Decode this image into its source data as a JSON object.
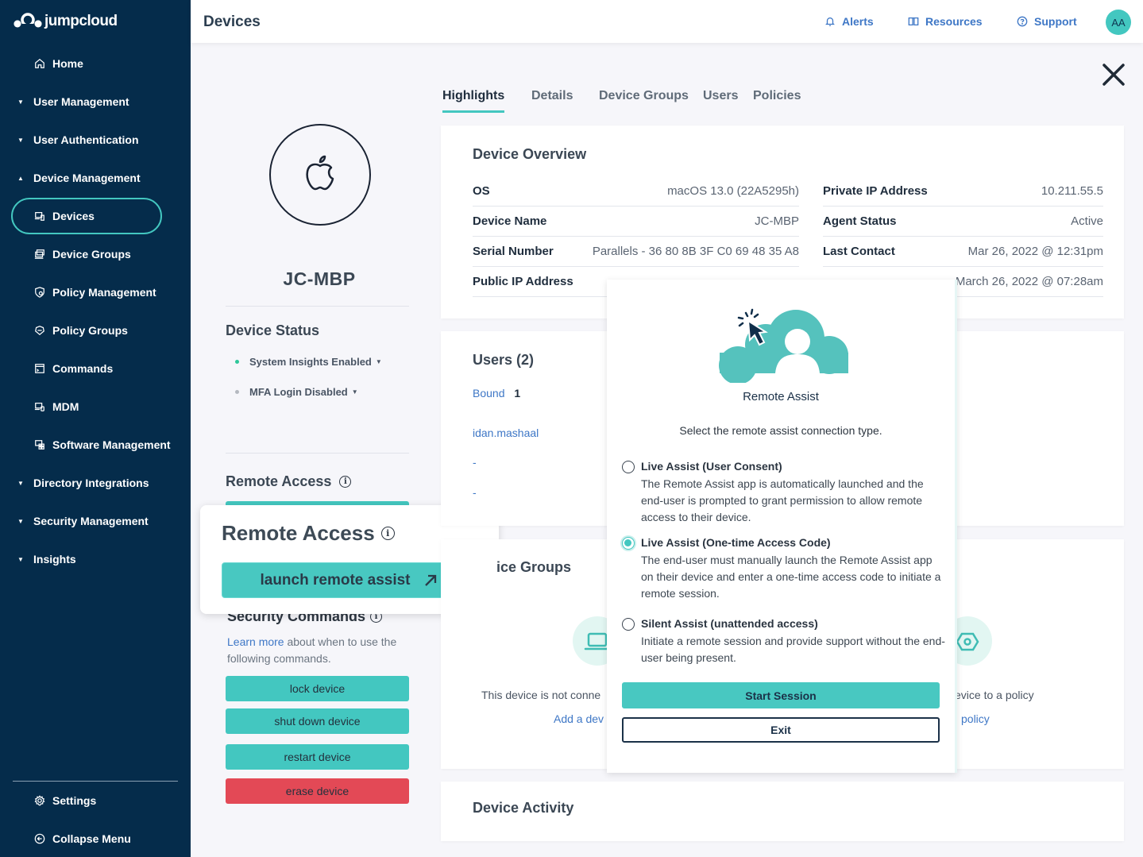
{
  "app": {
    "brand": "jumpcloud"
  },
  "sidebar": {
    "items": [
      {
        "label": "Home",
        "icon": "home-icon",
        "type": "top"
      },
      {
        "label": "User Management",
        "type": "group",
        "expanded": false
      },
      {
        "label": "User Authentication",
        "type": "group",
        "expanded": false
      },
      {
        "label": "Device Management",
        "type": "group",
        "expanded": true
      },
      {
        "label": "Devices",
        "icon": "devices-icon",
        "type": "child",
        "active": true
      },
      {
        "label": "Device Groups",
        "icon": "device-groups-icon",
        "type": "child"
      },
      {
        "label": "Policy Management",
        "icon": "policy-management-icon",
        "type": "child"
      },
      {
        "label": "Policy Groups",
        "icon": "policy-groups-icon",
        "type": "child"
      },
      {
        "label": "Commands",
        "icon": "commands-icon",
        "type": "child"
      },
      {
        "label": "MDM",
        "icon": "mdm-icon",
        "type": "child"
      },
      {
        "label": "Software Management",
        "icon": "software-management-icon",
        "type": "child"
      },
      {
        "label": "Directory Integrations",
        "type": "group",
        "expanded": false
      },
      {
        "label": "Security Management",
        "type": "group",
        "expanded": false
      },
      {
        "label": "Insights",
        "type": "group",
        "expanded": false
      }
    ],
    "footer": [
      {
        "label": "Settings",
        "icon": "gear-icon"
      },
      {
        "label": "Collapse Menu",
        "icon": "collapse-icon"
      }
    ]
  },
  "header": {
    "title": "Devices",
    "links": [
      {
        "label": "Alerts",
        "icon": "bell-icon"
      },
      {
        "label": "Resources",
        "icon": "book-icon"
      },
      {
        "label": "Support",
        "icon": "help-icon"
      }
    ],
    "avatar_initials": "AA"
  },
  "device": {
    "name": "JC-MBP",
    "os_icon": "apple-icon",
    "status_title": "Device Status",
    "statuses": [
      {
        "label": "System Insights Enabled",
        "color": "#2ec79a"
      },
      {
        "label": "MFA Login Disabled",
        "color": "#b5b9c0"
      }
    ],
    "remote_access_title": "Remote Access",
    "remote_access_popup": {
      "title": "Remote Access",
      "launch_label": "launch remote assist"
    },
    "security_commands": {
      "title": "Security Commands",
      "learn_more": "Learn more",
      "desc_rest": " about when to use the following commands.",
      "buttons": [
        "lock device",
        "shut down device",
        "restart device",
        "erase device"
      ]
    }
  },
  "tabs": [
    {
      "label": "Highlights",
      "active": true
    },
    {
      "label": "Details"
    },
    {
      "label": "Device Groups"
    },
    {
      "label": "Users"
    },
    {
      "label": "Policies"
    }
  ],
  "overview": {
    "title": "Device Overview",
    "left": [
      {
        "k": "OS",
        "v": "macOS 13.0 (22A5295h)"
      },
      {
        "k": "Device Name",
        "v": "JC-MBP"
      },
      {
        "k": "Serial Number",
        "v": "Parallels - 36 80 8B 3F C0 69 48 35 A8"
      },
      {
        "k": "Public IP Address",
        "v": ""
      }
    ],
    "right": [
      {
        "k": "Private IP Address",
        "v": "10.211.55.5"
      },
      {
        "k": "Agent Status",
        "v": "Active"
      },
      {
        "k": "Last Contact",
        "v": "Mar 26, 2022 @ 12:31pm"
      },
      {
        "k": "",
        "v": "March 26, 2022 @ 07:28am"
      }
    ]
  },
  "users": {
    "title": "Users (2)",
    "bound_label": "Bound",
    "bound_count": "1",
    "list": [
      "idan.mashaal",
      "-",
      "-"
    ]
  },
  "device_groups": {
    "title": "ice Groups",
    "empty_text": "This device is not conne",
    "add_link": "Add a dev"
  },
  "policies": {
    "empty_text": "evice to a policy",
    "add_link": "policy"
  },
  "activity": {
    "title": "Device Activity"
  },
  "remote_assist_modal": {
    "title": "Remote Assist",
    "subtitle": "Select the remote assist connection type.",
    "options": [
      {
        "title": "Live Assist (User Consent)",
        "desc": "The Remote Assist app is automatically launched and the end-user is prompted to grant permission to allow remote access to their device.",
        "selected": false
      },
      {
        "title": "Live Assist (One-time Access Code)",
        "desc": "The end-user must manually launch the Remote Assist app on their device and enter a one-time access code to initiate a remote session.",
        "selected": true
      },
      {
        "title": "Silent Assist (unattended access)",
        "desc": "Initiate a remote session and provide support without the end-user being present.",
        "selected": false
      }
    ],
    "start_label": "Start Session",
    "exit_label": "Exit"
  },
  "colors": {
    "sidebar_bg": "#052c4b",
    "accent": "#43c7c0",
    "danger": "#e34956",
    "link": "#3e77c6"
  }
}
